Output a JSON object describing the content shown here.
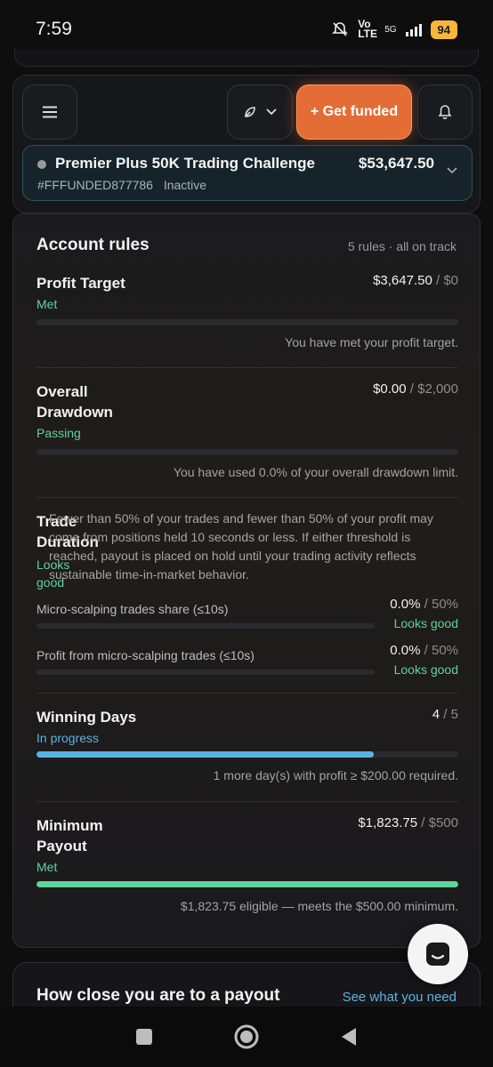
{
  "status_bar": {
    "time": "7:59",
    "network": "Vo LTE",
    "signal": "5G",
    "battery": "94"
  },
  "header": {
    "get_funded_label": "+ Get funded"
  },
  "challenge": {
    "name": "Premier Plus 50K Trading Challenge",
    "id": "#FFFUNDED877786",
    "state": "Inactive",
    "balance": "$53,647.50"
  },
  "rules": {
    "title": "Account rules",
    "summary": "5 rules · all on track",
    "profit_target": {
      "name": "Profit Target",
      "status": "Met",
      "value": "$3,647.50",
      "limit": " / $0",
      "progress": 0,
      "note": "You have met your profit target."
    },
    "overall_drawdown": {
      "name": "Overall Drawdown",
      "status": "Passing",
      "value": "$0.00",
      "limit": " / $2,000",
      "progress": 0,
      "note": "You have used 0.0% of your overall drawdown limit."
    },
    "trade_duration": {
      "name": "Trade Duration",
      "status": "Looks good",
      "description": "Fewer than 50% of your trades and fewer than 50% of your profit may come from positions held 10 seconds or less. If either threshold is reached, payout is placed on hold until your trading activity reflects sustainable time-in-market behavior.",
      "micro_share_label": "Micro-scalping trades share (≤10s)",
      "micro_share_value": "0.0%",
      "micro_share_limit": " / 50%",
      "micro_share_status": "Looks good",
      "micro_profit_label": "Profit from micro-scalping trades (≤10s)",
      "micro_profit_value": "0.0%",
      "micro_profit_limit": " / 50%",
      "micro_profit_status": "Looks good"
    },
    "winning_days": {
      "name": "Winning Days",
      "status": "In progress",
      "value": "4",
      "limit": " / 5",
      "progress": 0.8,
      "note": "1 more day(s) with profit ≥ $200.00 required."
    },
    "minimum_payout": {
      "name": "Minimum Payout",
      "status": "Met",
      "value": "$1,823.75",
      "limit": " / $500",
      "progress": 1.0,
      "note": "$1,823.75 eligible — meets the $500.00 minimum."
    }
  },
  "payout": {
    "title": "How close you are to a payout",
    "link": "See what you need"
  },
  "colors": {
    "accent": "#e46d36",
    "met": "#5fd39a",
    "progress": "#5ab4e3"
  }
}
